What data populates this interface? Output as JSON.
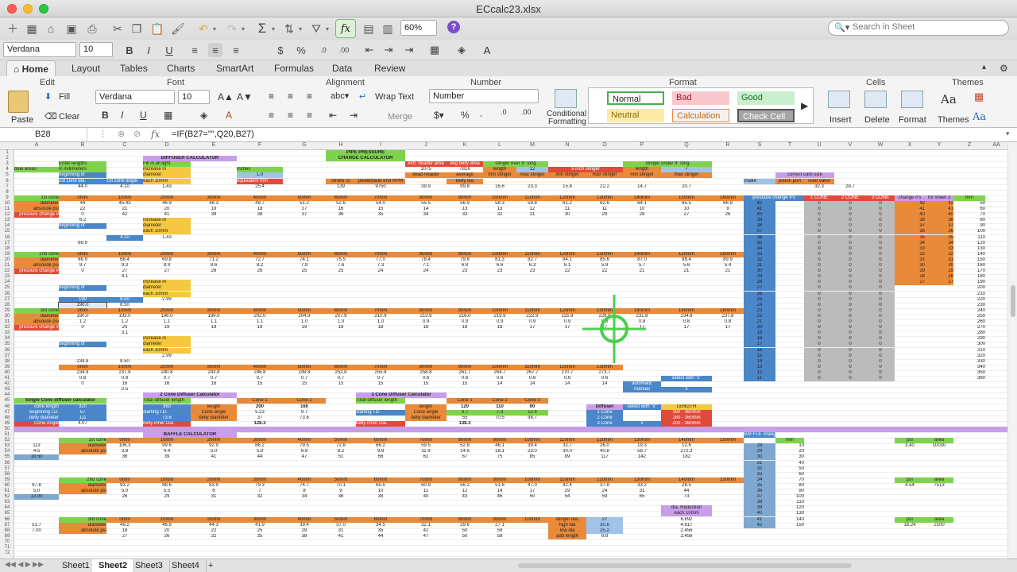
{
  "window": {
    "title": "ECcalc23.xlsx"
  },
  "toolbar": {
    "zoom": "60%",
    "search_placeholder": "Search in Sheet",
    "font_name": "Verdana",
    "font_size": "10",
    "sum_symbol": "Σ",
    "fx_symbol": "fx"
  },
  "tabs": [
    "Home",
    "Layout",
    "Tables",
    "Charts",
    "SmartArt",
    "Formulas",
    "Data",
    "Review"
  ],
  "ribbon": {
    "edit_title": "Edit",
    "font_title": "Font",
    "alignment_title": "Alignment",
    "number_title": "Number",
    "format_title": "Format",
    "cells_title": "Cells",
    "themes_title": "Themes",
    "paste": "Paste",
    "fill": "Fill",
    "clear": "Clear",
    "font_name": "Verdana",
    "font_size": "10",
    "wrap_text": "Wrap Text",
    "merge": "Merge",
    "number_format": "Number",
    "conditional_formatting_1": "Conditional",
    "conditional_formatting_2": "Formatting",
    "styles": {
      "normal": "Normal",
      "bad": "Bad",
      "good": "Good",
      "neutral": "Neutral",
      "calculation": "Calculation",
      "check_cell": "Check Cell"
    },
    "insert": "Insert",
    "delete": "Delete",
    "format": "Format",
    "themes": "Themes",
    "themes_aa": "Aa"
  },
  "formula_bar": {
    "cell_ref": "B28",
    "formula": "=IF(B27=\"\",Q20,B27)"
  },
  "columns": [
    "A",
    "B",
    "C",
    "D",
    "E",
    "F",
    "G",
    "H",
    "I",
    "J",
    "K",
    "L",
    "M",
    "N",
    "O",
    "P",
    "Q",
    "R",
    "S",
    "T",
    "U",
    "V",
    "W",
    "X",
    "Y",
    "Z",
    "AA"
  ],
  "rows": [
    "1",
    "2",
    "3",
    "4",
    "5",
    "6",
    "7",
    "8",
    "9",
    "10",
    "11",
    "12",
    "13",
    "14",
    "15",
    "16",
    "17",
    "18",
    "19",
    "20",
    "21",
    "22",
    "23",
    "24",
    "25",
    "26",
    "27",
    "28",
    "29",
    "30",
    "31",
    "32",
    "33",
    "34",
    "35",
    "36",
    "37",
    "38",
    "39",
    "40",
    "41",
    "42",
    "43",
    "44",
    "45",
    "46",
    "47",
    "48",
    "49",
    "50",
    "51",
    "52",
    "53",
    "54",
    "55",
    "56",
    "57",
    "58",
    "59",
    "60",
    "61",
    "62",
    "63",
    "64",
    "65",
    "66",
    "67",
    "68",
    "69",
    "70",
    "71",
    "72"
  ],
  "sheet": {
    "headers": {
      "diffuser": "DIFFUSER   CALCULATOR",
      "pipe1": "PIPE   PRESSURE",
      "pipe2": "CHANGE  CALCULATOR",
      "baffle": "BAFFLE  CALCULATOR",
      "two_cone": "2 Cone Diffuser   Calculator",
      "three_cone": "3 Cone Diffuser   Calculator",
      "single_cone": "Single Cone   diffuser calculator"
    },
    "labels": {
      "fill_light": "Fill in all light",
      "blue_areas": "blue areas",
      "enter_lengths": "Enter lengths",
      "mm": "in millimeters",
      "beginning": "beginning of",
      "first_cone_dia": "1st cone dia.",
      "first_cone_angle": "1st cone angle",
      "increase_in": "increase in",
      "diameter": "diameter",
      "each_10mm": "each 10mm",
      "inches": "inches",
      "equivalent_mm": "equivalent mm",
      "header_area": "exh. header area",
      "avg_belly": "avg belly area",
      "stinger_over": "stinger  over 9\" long",
      "stinger_under": "stinger  under 9\" long",
      "length": "length",
      "five_inch_stinger": "5 inch  stinger",
      "dead_header": "dead header",
      "average": "average",
      "belly_dia": "belly dia",
      "min_stinger": "min stinger",
      "max_stinger": "max stinger",
      "stroke_cc": "stroke cc",
      "powerband_rpm": "powerband end RPM",
      "intake": "intake",
      "piston_port": "piston port",
      "reed_valve": "reed valve",
      "correct_carb": "correct carb size",
      "pressure_change": "pressure change #'s",
      "cone_1": "1 CONE",
      "cone_2": "2 CONE",
      "cone_3": "3 CONE",
      "change_nums": "change #'s",
      "for_sheet3": "for sheet 3",
      "mm_col": "mm",
      "first_cone": "1st cone",
      "second_cone": "2nd cone",
      "third_cone": "3rd cone",
      "diameter_label": "diameter",
      "absolute_psi": "absolute psi",
      "pressure_change_lbl": "pressure change #",
      "automatic": "automatic",
      "manual": "manual",
      "select_x": "select with \"x\"",
      "x": "x",
      "diffuser": "Diffuser",
      "length_caps": "LENGTH",
      "one_cone": "1 Cone",
      "two_cone_lbl": "2 Cone",
      "three_cone_lbl": "3 Cone",
      "range1": "160 - 360mm",
      "range2": "180 - 360mm",
      "range3": "200 - 360mm",
      "cone_length": "cone length",
      "beginning_id": "beginning I.D.",
      "belly_diameter": "belly diameter",
      "cone_angle": "Cone Angle",
      "total_diffuser_length": "Total diffuser length",
      "starting_id": "starting I.D.",
      "belly_inner_dia": "belly inner Dia.",
      "cone1": "Cone 1",
      "cone2": "Cone 2",
      "cone3": "Cone 3",
      "cone_angle_lc": "Cone angle",
      "belly_diameter_b": "belly diameter",
      "baffle_change": "BAFFLE change #'s",
      "psi": "psi",
      "area": "area",
      "stinger_dia": "stinger dia.",
      "high_dia": "high dia",
      "low_dia": "low dia",
      "add_length": "add length",
      "dia_reduction": "dia. Reduction",
      "each_10mm_b": "each 10mm"
    },
    "mm_steps": [
      "0mm",
      "10mm",
      "20mm",
      "30mm",
      "40mm",
      "50mm",
      "60mm",
      "70mm",
      "80mm",
      "90mm",
      "100mm",
      "110mm",
      "120mm",
      "130mm",
      "140mm",
      "150mm",
      "160mm"
    ],
    "r7": [
      "44.0",
      "4.10",
      "1.43",
      "",
      "25.4",
      "",
      "139",
      "9750",
      "39.9",
      "99.8",
      "16.6",
      "23.3",
      "15.8",
      "22.2",
      "14.7",
      "20.7",
      "",
      "",
      "",
      "32.3",
      "28.7"
    ],
    "r10": [
      "44",
      "45.43",
      "46.9",
      "48.3",
      "49.7",
      "51.2",
      "52.6",
      "54.0",
      "55.5",
      "56.9",
      "58.3",
      "59.8",
      "61.2",
      "62.6",
      "64.1",
      "65.5",
      "66.9"
    ],
    "r11": [
      "22",
      "21",
      "20",
      "19",
      "18",
      "17",
      "16",
      "15",
      "14",
      "13",
      "13",
      "12",
      "11",
      "11",
      "10",
      "10",
      "9"
    ],
    "r12": [
      "0",
      "42",
      "41",
      "39",
      "38",
      "37",
      "36",
      "35",
      "34",
      "33",
      "32",
      "31",
      "30",
      "29",
      "28",
      "27",
      "26"
    ],
    "r20": [
      "66.9",
      "68.4",
      "69.8",
      "71.2",
      "72.7",
      "74.1",
      "75.5",
      "77.0",
      "78.4",
      "79.8",
      "81.3",
      "82.7",
      "84.1",
      "85.6",
      "87.0",
      "88.4",
      "89.9"
    ],
    "r21": [
      "9.7",
      "9.3",
      "8.9",
      "8.6",
      "8.2",
      "7.9",
      "7.6",
      "7.3",
      "7.1",
      "6.8",
      "6.6",
      "6.3",
      "6.1",
      "5.9",
      "5.7",
      "5.6",
      "5.4"
    ],
    "r22": [
      "0",
      "27",
      "27",
      "26",
      "26",
      "25",
      "25",
      "24",
      "24",
      "23",
      "23",
      "23",
      "22",
      "22",
      "21",
      "21",
      "21"
    ],
    "r30": [
      "190.0",
      "193.0",
      "196.0",
      "199.0",
      "202.0",
      "204.9",
      "207.9",
      "210.9",
      "213.9",
      "216.0",
      "219.9",
      "222.9",
      "225.9",
      "228.9",
      "231.8",
      "234.8",
      "237.8"
    ],
    "r31": [
      "1.2",
      "1.2",
      "1.1",
      "1.1",
      "1.1",
      "1.0",
      "1.0",
      "1.0",
      "0.9",
      "0.9",
      "0.9",
      "0.9",
      "0.9",
      "0.8",
      "0.8",
      "0.8",
      "0.8"
    ],
    "r32": [
      "0",
      "20",
      "19",
      "19",
      "19",
      "19",
      "18",
      "18",
      "18",
      "18",
      "18",
      "17",
      "17",
      "17",
      "17",
      "17",
      "17"
    ],
    "r40": [
      "234.8",
      "237.8",
      "240.8",
      "243.8",
      "246.8",
      "249.8",
      "252.8",
      "255.8",
      "258.8",
      "261.7",
      "264.7",
      "267.7",
      "270.7",
      "273.7"
    ],
    "r41": [
      "0.8",
      "0.8",
      "0.7",
      "0.7",
      "0.7",
      "0.7",
      "0.7",
      "0.7",
      "0.6",
      "0.6",
      "0.6",
      "0.6",
      "0.6",
      "0.6"
    ],
    "r42": [
      "0",
      "16",
      "16",
      "16",
      "15",
      "15",
      "15",
      "15",
      "15",
      "15",
      "14",
      "14",
      "14",
      "14"
    ],
    "r53": [
      "113",
      "106.3",
      "99.6",
      "92.9",
      "86.2",
      "79.5",
      "72.8",
      "66.2",
      "59.5",
      "52.8",
      "46.1",
      "39.4",
      "32.7",
      "26.0",
      "19.3",
      "12.6"
    ],
    "r54": [
      "4.5",
      "3.8",
      "4.4",
      "5.0",
      "5.8",
      "6.8",
      "8.2",
      "9.8",
      "11.9",
      "14.6",
      "18.1",
      "23.0",
      "30.0",
      "40.8",
      "58.7",
      "272.3"
    ],
    "r55": [
      "18.50",
      "36",
      "39",
      "41",
      "44",
      "47",
      "51",
      "56",
      "61",
      "67",
      "75",
      "85",
      "99",
      "117",
      "142",
      "182"
    ],
    "r60": [
      "97.8",
      "93.2",
      "88.6",
      "83.9",
      "79.3",
      "74.7",
      "70.1",
      "65.5",
      "60.9",
      "56.2",
      "51.6",
      "47.0",
      "42.4",
      "37.8",
      "33.2",
      "28.5"
    ],
    "r61": [
      "5.0",
      "5.0",
      "5.5",
      "6",
      "7",
      "8",
      "9",
      "10",
      "11",
      "12",
      "14",
      "17",
      "19",
      "24",
      "31",
      "44"
    ],
    "r62": [
      "13.00",
      "26",
      "29",
      "31",
      "32",
      "34",
      "36",
      "38",
      "40",
      "43",
      "46",
      "50",
      "54",
      "59",
      "65",
      "73"
    ],
    "r67": [
      "51.7",
      "49.2",
      "46.8",
      "44.3",
      "41.9",
      "39.4",
      "37.0",
      "34.5",
      "32.1",
      "29.6",
      "27.1"
    ],
    "r68": [
      "7.00",
      "18",
      "20",
      "22",
      "25",
      "28",
      "31",
      "35",
      "42",
      "50",
      "59"
    ],
    "r69": [
      "",
      "27",
      "26",
      "32",
      "35",
      "38",
      "41",
      "44",
      "47",
      "50",
      "58"
    ],
    "s_col": [
      "42",
      "41",
      "40",
      "39",
      "38",
      "37",
      "36",
      "35",
      "34",
      "33",
      "32",
      "31",
      "30",
      "29",
      "28",
      "27",
      "26",
      "25",
      "24",
      "23",
      "22",
      "21",
      "20",
      "19",
      "18",
      "17",
      "16",
      "15",
      "14",
      "13",
      "12",
      "11"
    ],
    "u_col": [
      "42",
      "41",
      "40",
      "38",
      "37",
      "36",
      "35",
      "34",
      "33",
      "32",
      "31",
      "30",
      "29",
      "28",
      "27"
    ],
    "z_col": [
      "50",
      "60",
      "70",
      "80",
      "90",
      "100",
      "110",
      "120",
      "130",
      "140",
      "150",
      "160",
      "170",
      "180",
      "190",
      "200",
      "210",
      "220",
      "230",
      "240",
      "250",
      "260",
      "270",
      "280",
      "290",
      "300",
      "310",
      "320",
      "330",
      "340",
      "350",
      "360"
    ],
    "single_vals": [
      "320",
      "57",
      "111",
      "4.07"
    ],
    "two_vals": [
      "360",
      "200",
      "160",
      "5.23",
      "9.7",
      "37",
      "73.6",
      "128.3"
    ],
    "three_vals": [
      "120",
      "110",
      "90",
      "3.7",
      "7.3",
      "12.4",
      "55",
      "70.5",
      "98.7",
      "138.3"
    ],
    "baffle_vals": [
      "3.40",
      "10030",
      "4.54",
      "7513",
      "16.24",
      "2100"
    ],
    "stinger_vals": [
      "27",
      "30.8",
      "25.2",
      "6.8",
      "6.692",
      "4.617",
      "2.456",
      "2.456"
    ],
    "baffle_col": [
      "28",
      "29",
      "30",
      "31",
      "32",
      "33",
      "34",
      "35",
      "36",
      "37",
      "38",
      "39",
      "40",
      "41",
      "42"
    ],
    "baffle_mm": [
      "10",
      "20",
      "30",
      "40",
      "50",
      "60",
      "70",
      "80",
      "90",
      "100",
      "110",
      "120",
      "130",
      "140",
      "150"
    ],
    "misc_1075": "1075",
    "misc_7816": "7816",
    "misc_12": "12",
    "misc_7": "7",
    "misc_1_0": "1.0",
    "misc_6_2": "6.2",
    "misc_4_1": "4.1",
    "misc_3_1": "3.1",
    "misc_2_5": "2.5",
    "misc_8_50": "8.50",
    "misc_190_0": "190.0",
    "misc_190": "190",
    "misc_2_99": "2.99",
    "misc_1_43": "1.43",
    "misc_66_9": "66.9",
    "misc_4_10": "4.10"
  },
  "sheet_tabs": [
    "Sheet1",
    "Sheet2",
    "Sheet3",
    "Sheet4"
  ],
  "sheet_tab_add": "+",
  "colors": {
    "blue": "#4a86c8",
    "orange": "#e98a3a",
    "yellow": "#f5c842",
    "green": "#7fd34c",
    "purple": "#c79ee8",
    "red": "#e04a3a",
    "light_blue": "#9fc4e8",
    "steel": "#7fa8d0"
  }
}
